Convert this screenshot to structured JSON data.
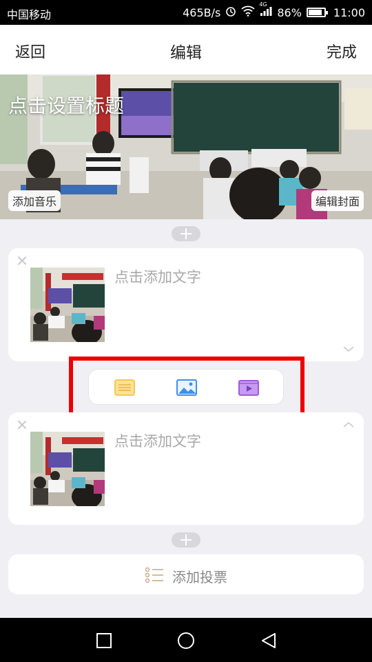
{
  "status_bar": {
    "carrier": "中国移动",
    "speed": "465B/s",
    "network": "4G",
    "battery": "86%",
    "battery_level": 0.86,
    "time": "11:00",
    "icons": [
      "alarm-icon",
      "wifi-icon",
      "signal-icon",
      "battery-icon"
    ]
  },
  "nav": {
    "back": "返回",
    "title": "编辑",
    "done": "完成"
  },
  "cover": {
    "title": "点击设置标题",
    "music_button": "添加音乐",
    "edit_cover_button": "编辑封面"
  },
  "cards": [
    {
      "placeholder": "点击添加文字",
      "chevron": "chevron-down-icon"
    },
    {
      "placeholder": "点击添加文字",
      "chevron": "chevron-up-icon"
    }
  ],
  "toolbar": {
    "tools": [
      "text-icon",
      "image-icon",
      "video-icon"
    ],
    "colors": {
      "text": "#f7c84a",
      "image": "#3d8ff0",
      "video": "#9b5be0",
      "highlight": "#ee0000"
    }
  },
  "vote": {
    "label": "添加投票"
  },
  "android_nav": [
    "square-icon",
    "home-circle-icon",
    "back-triangle-icon"
  ]
}
